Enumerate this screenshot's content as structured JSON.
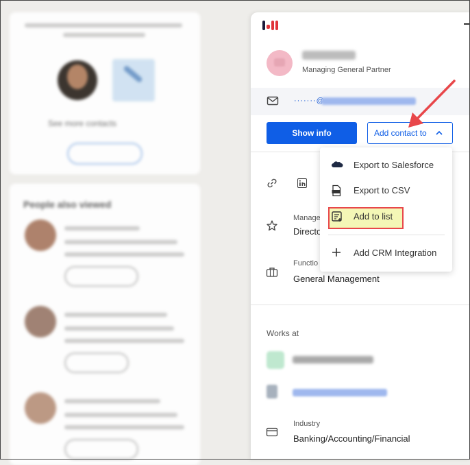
{
  "background": {
    "card_top": {
      "promo_text": "See more contacts"
    },
    "people_card": {
      "heading": "People also viewed"
    }
  },
  "panel": {
    "brand_colors": [
      "#1a1a3a",
      "#e0343a",
      "#e0343a",
      "#e0343a"
    ],
    "contact": {
      "title": "Managing General Partner",
      "email_prefix": "·······@"
    },
    "buttons": {
      "show_info": "Show info",
      "add_contact": "Add contact to"
    },
    "fields": {
      "management_label": "Manage",
      "management_value": "Directo",
      "function_label": "Functio",
      "function_value": "General Management"
    },
    "works_at": {
      "heading": "Works at",
      "industry_label": "Industry",
      "industry_value": "Banking/Accounting/Financial"
    }
  },
  "dropdown": {
    "items": [
      {
        "label": "Export to Salesforce",
        "icon": "salesforce-icon"
      },
      {
        "label": "Export to CSV",
        "icon": "csv-file-icon"
      },
      {
        "label": "Add to list",
        "icon": "add-list-icon"
      },
      {
        "label": "Add CRM Integration",
        "icon": "plus-icon"
      }
    ]
  },
  "colors": {
    "accent": "#0f5ee6",
    "annotation": "#e8474a",
    "highlight": "#f4f7b6"
  }
}
